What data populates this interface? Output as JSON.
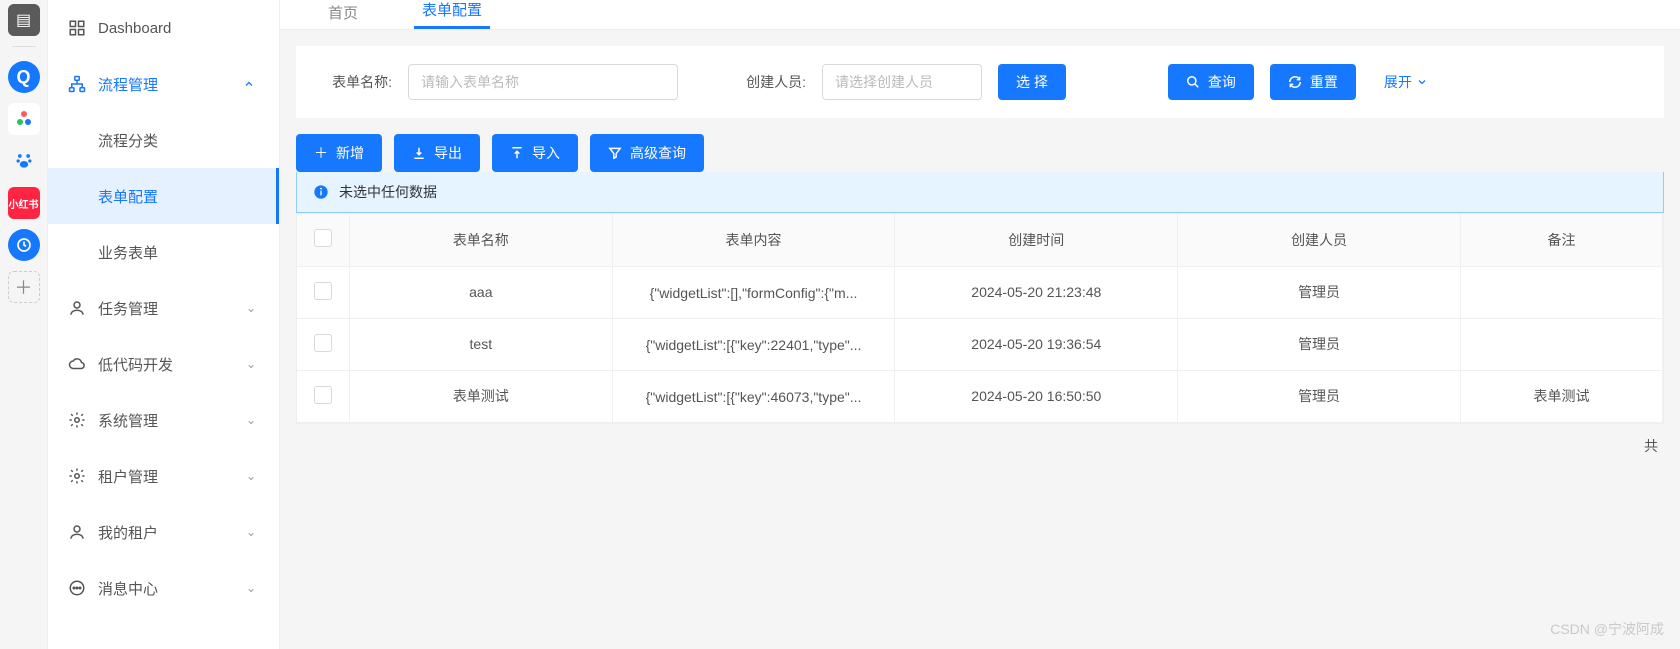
{
  "rail": {
    "redLabel": "小红书"
  },
  "sidebar": {
    "dashboard": "Dashboard",
    "items": [
      {
        "label": "流程管理",
        "expanded": true
      },
      {
        "label": "任务管理"
      },
      {
        "label": "低代码开发"
      },
      {
        "label": "系统管理"
      },
      {
        "label": "租户管理"
      },
      {
        "label": "我的租户"
      },
      {
        "label": "消息中心"
      }
    ],
    "subitems": [
      {
        "label": "流程分类"
      },
      {
        "label": "表单配置",
        "selected": true
      },
      {
        "label": "业务表单"
      }
    ]
  },
  "tabs": [
    {
      "label": "首页"
    },
    {
      "label": "表单配置",
      "active": true
    }
  ],
  "filter": {
    "nameLabel": "表单名称:",
    "namePlaceholder": "请输入表单名称",
    "creatorLabel": "创建人员:",
    "creatorPlaceholder": "请选择创建人员",
    "selectBtn": "选 择",
    "searchBtn": "查询",
    "resetBtn": "重置",
    "expand": "展开"
  },
  "toolbar": {
    "new": "新增",
    "export": "导出",
    "import": "导入",
    "advanced": "高级查询"
  },
  "alert": {
    "text": "未选中任何数据"
  },
  "table": {
    "columns": [
      "表单名称",
      "表单内容",
      "创建时间",
      "创建人员",
      "备注"
    ],
    "rows": [
      {
        "name": "aaa",
        "content": "{\"widgetList\":[],\"formConfig\":{\"m...",
        "time": "2024-05-20 21:23:48",
        "creator": "管理员",
        "note": ""
      },
      {
        "name": "test",
        "content": "{\"widgetList\":[{\"key\":22401,\"type\"...",
        "time": "2024-05-20 19:36:54",
        "creator": "管理员",
        "note": ""
      },
      {
        "name": "表单测试",
        "content": "{\"widgetList\":[{\"key\":46073,\"type\"...",
        "time": "2024-05-20 16:50:50",
        "creator": "管理员",
        "note": "表单测试"
      }
    ]
  },
  "footer": {
    "totalPrefix": "共"
  },
  "watermark": "CSDN @宁波阿成"
}
